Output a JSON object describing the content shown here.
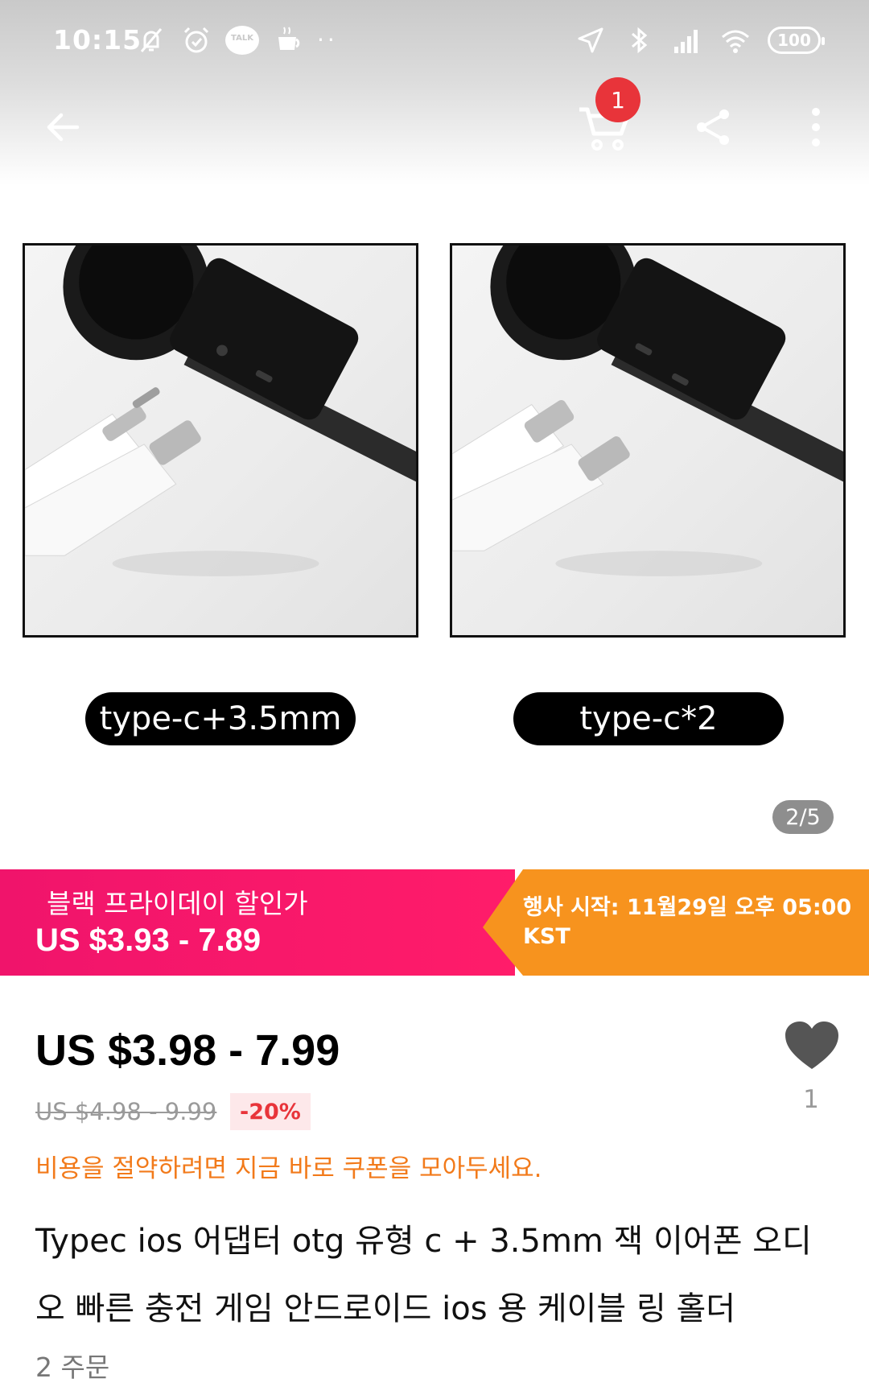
{
  "status_bar": {
    "time": "10:15",
    "talk_label": "TALK",
    "battery": "100"
  },
  "nav": {
    "cart_badge": "1"
  },
  "gallery": {
    "variants": [
      {
        "label": "type-c+3.5mm"
      },
      {
        "label": "type-c*2"
      }
    ],
    "page_indicator": "2/5"
  },
  "promo": {
    "label": "블랙 프라이데이 할인가",
    "price": "US $3.93 - 7.89",
    "event": "행사 시작: 11월29일 오후 05:00 KST",
    "colors": {
      "left": "#f0146b",
      "right": "#f7931e"
    }
  },
  "product": {
    "current_price": "US $3.98 - 7.99",
    "original_price": "US $4.98 - 9.99",
    "discount": "-20%",
    "coupon_hint": "비용을 절약하려면 지금 바로 쿠폰을 모아두세요.",
    "favorites_count": "1",
    "title": "Typec ios 어댑터 otg 유형 c + 3.5mm 잭 이어폰 오디오 빠른 충전 게임 안드로이드 ios 용 케이블 링 홀더",
    "orders": "2 주문"
  }
}
